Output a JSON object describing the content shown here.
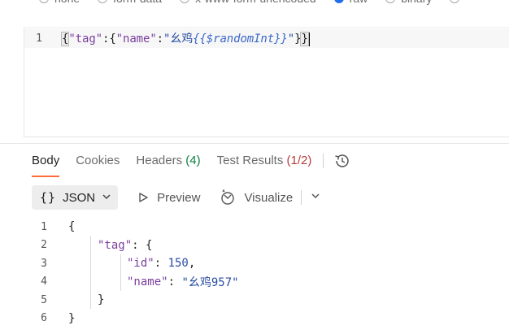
{
  "body_types": [
    {
      "label": "none",
      "checked": false
    },
    {
      "label": "form-data",
      "checked": false
    },
    {
      "label": "x-www-form-urlencoded",
      "checked": false
    },
    {
      "label": "raw",
      "checked": true
    },
    {
      "label": "binary",
      "checked": false
    },
    {
      "label": "",
      "checked": false
    }
  ],
  "request_editor": {
    "line_number": "1",
    "brace_open": "{",
    "key_tag": "\"tag\"",
    "colon1": ":{",
    "key_name": "\"name\"",
    "colon2": ":",
    "str_prefix": "\"幺鸡",
    "variable": "{{$randomInt}}",
    "str_suffix": "\"",
    "inner_close": "}",
    "brace_close": "}"
  },
  "response_tabs": {
    "body": "Body",
    "cookies": "Cookies",
    "headers": "Headers",
    "headers_count": "(4)",
    "tests": "Test Results",
    "tests_count": "(1/2)"
  },
  "toolbar": {
    "format_braces": "{}",
    "format_label": "JSON",
    "preview": "Preview",
    "visualize": "Visualize"
  },
  "response_body": {
    "lines": [
      {
        "num": "1",
        "text": "{"
      },
      {
        "num": "2",
        "key": "\"tag\"",
        "after": ": {"
      },
      {
        "num": "3",
        "key": "\"id\"",
        "after": ": ",
        "value": "150",
        "tail": ","
      },
      {
        "num": "4",
        "key": "\"name\"",
        "after": ": ",
        "value": "\"幺鸡957\""
      },
      {
        "num": "5",
        "text": "}"
      },
      {
        "num": "6",
        "text": "}"
      }
    ]
  },
  "colors": {
    "accent": "#ff6c37",
    "radio_checked": "#1f6feb",
    "count_green": "#0a7f3f",
    "count_red": "#b43c3c"
  }
}
